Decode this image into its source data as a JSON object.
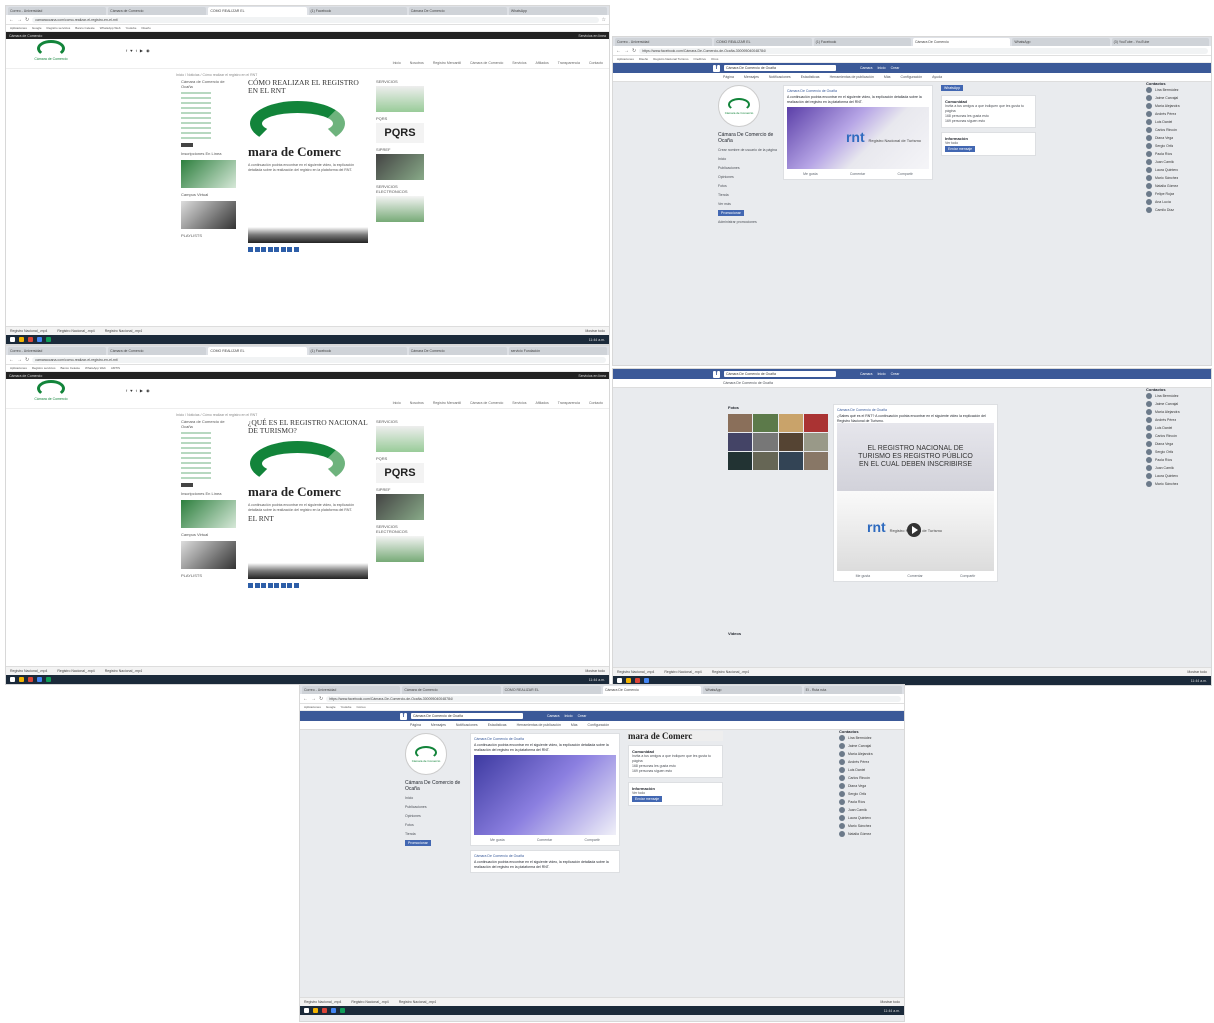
{
  "browser": {
    "tabs": [
      "Correo - Universidad",
      "Cámara de Comercio",
      "COMO REALIZAR EL",
      "(1) Facebook",
      "Cámara De Comercio",
      "WhatsApp",
      "servicio Fundación",
      "El - Ruta ruta",
      "(3) YouTube - YouTube"
    ],
    "url_site": "camaraocana.com/como-realizar-el-registro-en-el-rnt/",
    "url_fb": "https://www.facebook.com/Cámara-De-Comercio-de-Ocaña-300095040048784/",
    "bookmarks": [
      "Aplicaciones",
      "Google",
      "Registro servicios",
      "Banco Celeste",
      "WhatsApp Web",
      "Youtube",
      "Diseño",
      "AMTIS",
      "Registro Nacional Turismo",
      "OneDrive",
      "Correo",
      "Otros"
    ],
    "downloads": [
      "Registro Nacional_.mp4",
      "Registro Nacional_.mp4",
      "Registro Nacional_.mp4"
    ],
    "downloads_right": "Mostrar todo",
    "clock": "11:44 a.m."
  },
  "site": {
    "topbar_left": "Cámara de Comercio",
    "topbar_right": "Servicios en línea",
    "logo_text": "Cámara de Comercio",
    "socials": "f ♥ t ▶ ◉",
    "nav": [
      "Inicio",
      "Nosotros",
      "Registro Mercantil",
      "Cámara de Comercio",
      "Servicios",
      "Afiliados",
      "Transparencia",
      "Contacto"
    ],
    "crumb": "Inicio / Noticias / Cómo realizar el registro en el RNT",
    "left_title": "Cámara de Comercio de Ocaña",
    "left_sub1": "Inscripciones En Línea",
    "left_sub2": "Campus Virtual",
    "left_bottom": "PLAYLISTS",
    "right_titles": [
      "SERVICIOS",
      "PQRS",
      "SIPREF",
      "SERVICIOS ELECTRONICOS"
    ],
    "post1_title": "CÓMO REALIZAR EL REGISTRO EN EL RNT",
    "post2_title": "¿QUÉ ES EL REGISTRO NACIONAL DE TURISMO?",
    "post2_link": "EL RNT",
    "big_text": "mara de Comerc",
    "para": "A continuación podrás encontrar en el siguiente video, la explicación detallada sobre la realización del registro en la plataforma del RNT."
  },
  "fb": {
    "search": "Cámara De Comercio de Ocaña",
    "nav": [
      "Camara",
      "Inicio",
      "Crear"
    ],
    "page_tabs": [
      "Página",
      "Mensajes",
      "Notificaciones",
      "Estadísticas",
      "Herramientas de publicación",
      "Más",
      "Configuración",
      "Ayuda"
    ],
    "page_name": "Cámara De Comercio de Ocaña",
    "page_sub": "Crear nombre de usuario de la página",
    "menu": [
      "Inicio",
      "Publicaciones",
      "Opiniones",
      "Fotos",
      "Tienda",
      "Ver más"
    ],
    "promote": "Promocionar",
    "manage": "Administrar promociones",
    "post_author": "Cámara De Comercio de Ocaña",
    "post_text": "A continuación podrás encontrar en el siguiente video, la explicación detallada sobre la realización del registro en la plataforma del RNT.",
    "rnt": "rnt",
    "rnt_label": "Registro Nacional de Turismo",
    "actions": [
      "Me gusta",
      "Comentar",
      "Compartir"
    ],
    "side_titles": [
      "Comunidad",
      "Información"
    ],
    "side_lines": [
      "Invita a tus amigos a que indiquen que les gusta tu página",
      "168 personas les gusta esto",
      "169 personas siguen esto",
      "Ver todo",
      "Enviar mensaje"
    ],
    "whatsapp": "WhatsApp",
    "chat_title": "Contactos",
    "contacts": [
      "Lina Bermúdez",
      "Jaime Carvajal",
      "María Alejandra",
      "Andrés Pérez",
      "Luis Daniel",
      "Carlos Rincón",
      "Diana Vega",
      "Sergio Ortiz",
      "Paola Ríos",
      "Juan Camilo",
      "Laura Quintero",
      "Mario Sánchez",
      "Natalia Gómez",
      "Felipe Rojas",
      "Ana Lucía",
      "Camilo Díaz"
    ],
    "post2_author": "Cámara De Comercio de Ocaña",
    "post2_text": "¿Sabes qué es el RNT? A continuación podrás encontrar en el siguiente video la explicación del Registro Nacional de Turismo.",
    "announce": "EL REGISTRO NACIONAL DE TURISMO ES REGISTRO PÚBLICO EN EL CUAL DEBEN INSCRIBIRSE",
    "fotos": "Fotos",
    "videos": "Videos"
  },
  "colors": {
    "brand_green": "#12843a",
    "fb_blue": "#3b5998"
  }
}
